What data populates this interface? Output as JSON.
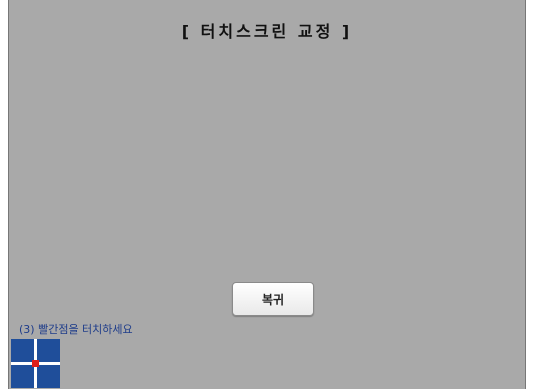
{
  "title": "[ 터치스크린 교정 ]",
  "restore_button": "복귀",
  "instruction": "(3) 빨간점을 터치하세요",
  "colors": {
    "background": "#a9a9a9",
    "instruction_text": "#1f3d8a",
    "target_fill": "#1f4e9a",
    "target_cross": "#ffffff",
    "target_dot": "#e0201a"
  },
  "icons": {
    "calibration_target": "crosshair-target-icon"
  }
}
